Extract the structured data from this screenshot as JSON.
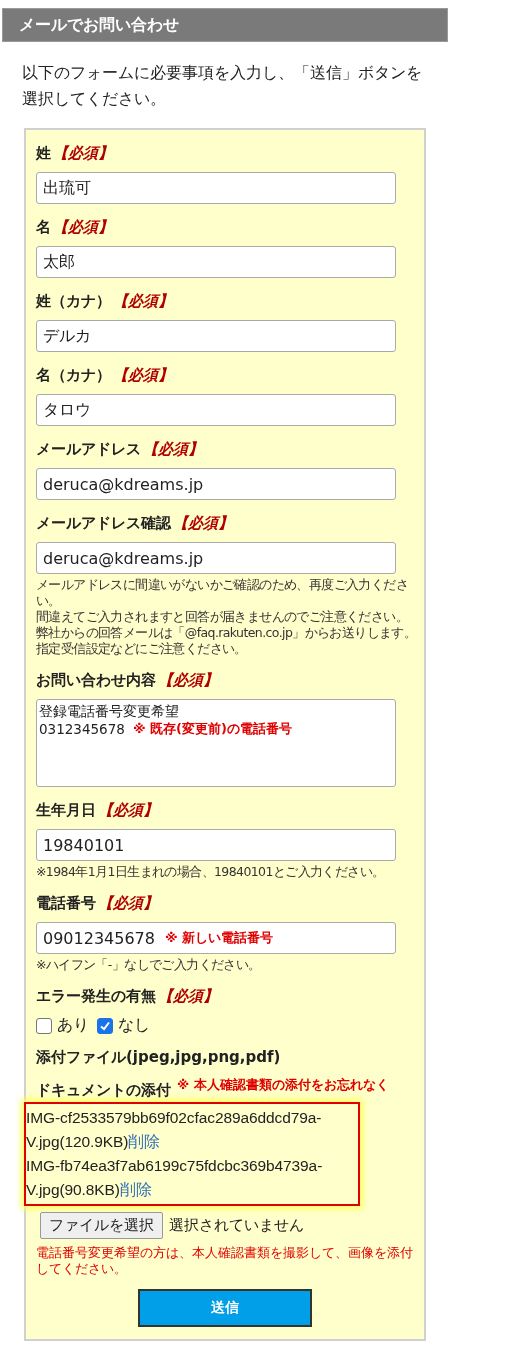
{
  "header": {
    "title": "メールでお問い合わせ"
  },
  "intro": "以下のフォームに必要事項を入力し、「送信」ボタンを選択してください。",
  "fields": [
    {
      "kind": "input",
      "label": "姓",
      "required": "【必須】",
      "value": "出琉可"
    },
    {
      "kind": "input",
      "label": "名",
      "required": "【必須】",
      "value": "太郎"
    },
    {
      "kind": "input",
      "label": "姓（カナ）",
      "required": "【必須】",
      "value": "デルカ"
    },
    {
      "kind": "input",
      "label": "名（カナ）",
      "required": "【必須】",
      "value": "タロウ"
    },
    {
      "kind": "input",
      "label": "メールアドレス",
      "required": "【必須】",
      "value": "deruca@kdreams.jp"
    },
    {
      "kind": "input",
      "label": "メールアドレス確認",
      "required": "【必須】",
      "value": "deruca@kdreams.jp",
      "note_lines": [
        "メールアドレスに間違いがないかご確認のため、再度ご入力ください。",
        "間違えてご入力されますと回答が届きませんのでご注意ください。",
        "弊社からの回答メールは「@faq.rakuten.co.jp」からお送りします。",
        "指定受信設定などにご注意ください。"
      ]
    },
    {
      "kind": "textarea",
      "label": "お問い合わせ内容",
      "required": "【必須】",
      "lines": [
        "登録電話番号変更希望",
        "0312345678"
      ],
      "annotation": "※ 既存(変更前)の電話番号"
    },
    {
      "kind": "input",
      "label": "生年月日",
      "required": "【必須】",
      "value": "19840101",
      "note": "※1984年1月1日生まれの場合、19840101とご入力ください。"
    },
    {
      "kind": "input",
      "label": "電話番号",
      "required": "【必須】",
      "value": "09012345678",
      "annotation": "※ 新しい電話番号",
      "note": "※ハイフン「-」なしでご入力ください。"
    },
    {
      "kind": "checkboxes",
      "label": "エラー発生の有無",
      "required": "【必須】",
      "options": [
        {
          "label": "あり",
          "checked": false
        },
        {
          "label": "なし",
          "checked": true
        }
      ]
    }
  ],
  "attachment": {
    "title": "添付ファイル(jpeg,jpg,png,pdf)",
    "label": "ドキュメントの添付",
    "annotation": "※ 本人確認書類の添付をお忘れなく",
    "files": [
      {
        "name": "IMG-cf2533579bb69f02cfac289a6ddcd79a-V.jpg(120.9KB)",
        "delete": "削除"
      },
      {
        "name": "IMG-fb74ea3f7ab6199c75fdcbc369b4739a-V.jpg(90.8KB)",
        "delete": "削除"
      }
    ],
    "choose_button": "ファイルを選択",
    "no_file": "選択されていません",
    "note": "電話番号変更希望の方は、本人確認書類を撮影して、画像を添付してください。"
  },
  "submit": "送信"
}
